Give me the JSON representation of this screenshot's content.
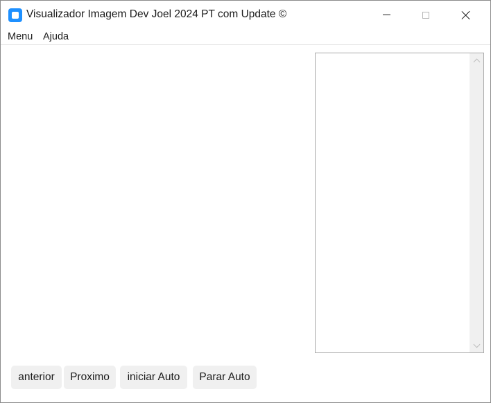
{
  "window": {
    "title": "Visualizador Imagem Dev Joel 2024 PT com Update ©",
    "controls": {
      "minimize": "minimize-icon",
      "maximize": "maximize-icon",
      "close": "close-icon"
    }
  },
  "menubar": {
    "items": [
      {
        "label": "Menu"
      },
      {
        "label": "Ajuda"
      }
    ]
  },
  "listbox": {
    "items": []
  },
  "buttons": {
    "previous": "anterior",
    "next": "Proximo",
    "start_auto": "iniciar Auto",
    "stop_auto": "Parar Auto"
  },
  "colors": {
    "app_icon": "#1e90ff",
    "button_bg": "#f0f0f0",
    "scrollbar_bg": "#f0f0f0"
  }
}
